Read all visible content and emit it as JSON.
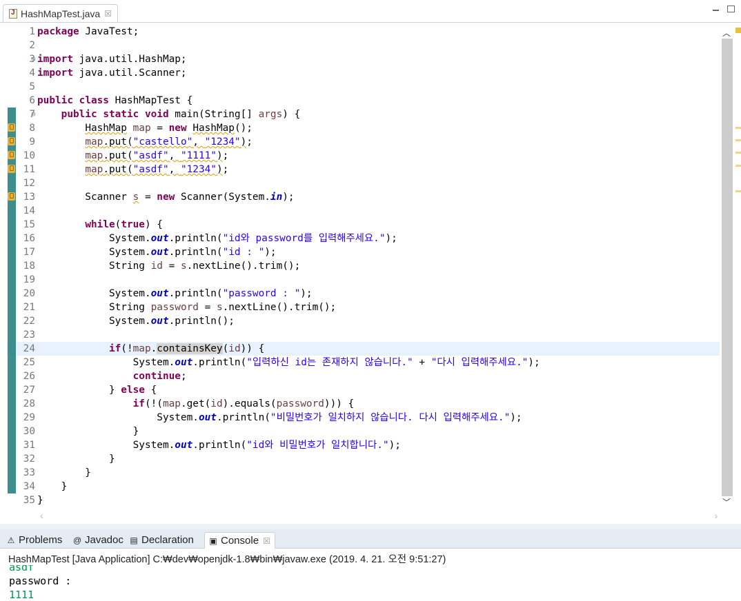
{
  "editor": {
    "tab_title": "HashMapTest.java",
    "close_glyph": "☒"
  },
  "code_lines": [
    {
      "n": "1",
      "html": "<span class=\"kw\">package</span> JavaTest;"
    },
    {
      "n": "2",
      "html": ""
    },
    {
      "n": "3",
      "html": "<span class=\"kw\">import</span> java.util.HashMap;",
      "fold": "⊖"
    },
    {
      "n": "4",
      "html": "<span class=\"kw\">import</span> java.util.Scanner;"
    },
    {
      "n": "5",
      "html": ""
    },
    {
      "n": "6",
      "html": "<span class=\"kw\">public</span> <span class=\"kw\">class</span> HashMapTest {"
    },
    {
      "n": "7",
      "html": "    <span class=\"kw\">public</span> <span class=\"kw\">static</span> <span class=\"kw\">void</span> main(String[] <span class=\"var\">args</span>) {",
      "fold": "⊖",
      "bar": true
    },
    {
      "n": "8",
      "html": "        <span class=\"warnu\">HashMap</span> <span class=\"var\">map</span> = <span class=\"kw\">new</span> <span class=\"warnu\">HashMap</span>();",
      "bar": true,
      "warn": true
    },
    {
      "n": "9",
      "html": "        <span class=\"warnu\"><span class=\"var\">map</span>.put(<span class=\"str\">\"castello\"</span>, <span class=\"str\">\"1234\"</span>)</span>;",
      "bar": true,
      "warn": true
    },
    {
      "n": "10",
      "html": "        <span class=\"warnu\"><span class=\"var\">map</span>.put(<span class=\"str\">\"asdf\"</span>, <span class=\"str\">\"1111\"</span>)</span>;",
      "bar": true,
      "warn": true
    },
    {
      "n": "11",
      "html": "        <span class=\"warnu\"><span class=\"var\">map</span>.put(<span class=\"str\">\"asdf\"</span>, <span class=\"str\">\"1234\"</span>)</span>;",
      "bar": true,
      "warn": true
    },
    {
      "n": "12",
      "html": "",
      "bar": true
    },
    {
      "n": "13",
      "html": "        Scanner <span class=\"var warnu\">s</span> = <span class=\"kw\">new</span> Scanner(System.<span class=\"fld\">in</span>);",
      "bar": true,
      "warn": true
    },
    {
      "n": "14",
      "html": "",
      "bar": true
    },
    {
      "n": "15",
      "html": "        <span class=\"kw\">while</span>(<span class=\"kw\">true</span>) {",
      "bar": true
    },
    {
      "n": "16",
      "html": "            System.<span class=\"fld\">out</span>.println(<span class=\"str\">\"id와 password를 입력해주세요.\"</span>);",
      "bar": true
    },
    {
      "n": "17",
      "html": "            System.<span class=\"fld\">out</span>.println(<span class=\"str\">\"id : \"</span>);",
      "bar": true
    },
    {
      "n": "18",
      "html": "            String <span class=\"var\">id</span> = <span class=\"var\">s</span>.nextLine().trim();",
      "bar": true
    },
    {
      "n": "19",
      "html": "",
      "bar": true
    },
    {
      "n": "20",
      "html": "            System.<span class=\"fld\">out</span>.println(<span class=\"str\">\"password : \"</span>);",
      "bar": true
    },
    {
      "n": "21",
      "html": "            String <span class=\"var\">password</span> = <span class=\"var\">s</span>.nextLine().trim();",
      "bar": true
    },
    {
      "n": "22",
      "html": "            System.<span class=\"fld\">out</span>.println();",
      "bar": true
    },
    {
      "n": "23",
      "html": "",
      "bar": true
    },
    {
      "n": "24",
      "html": "            <span class=\"kw\">if</span>(!<span class=\"var\">map</span>.<span class=\"hl\">containsKey</span>(<span class=\"var\">id</span>)) {",
      "bar": true,
      "current": true
    },
    {
      "n": "25",
      "html": "                System.<span class=\"fld\">out</span>.println(<span class=\"str\">\"입력하신 id는 존재하지 않습니다.\"</span> + <span class=\"str\">\"다시 입력해주세요.\"</span>);",
      "bar": true
    },
    {
      "n": "26",
      "html": "                <span class=\"kw\">continue</span>;",
      "bar": true
    },
    {
      "n": "27",
      "html": "            } <span class=\"kw\">else</span> {",
      "bar": true
    },
    {
      "n": "28",
      "html": "                <span class=\"kw\">if</span>(!(<span class=\"var\">map</span>.get(<span class=\"var\">id</span>).equals(<span class=\"var\">password</span>))) {",
      "bar": true
    },
    {
      "n": "29",
      "html": "                    System.<span class=\"fld\">out</span>.println(<span class=\"str\">\"비밀번호가 일치하지 않습니다. 다시 입력해주세요.\"</span>);",
      "bar": true
    },
    {
      "n": "30",
      "html": "                }",
      "bar": true
    },
    {
      "n": "31",
      "html": "                System.<span class=\"fld\">out</span>.println(<span class=\"str\">\"id와 비밀번호가 일치합니다.\"</span>);",
      "bar": true
    },
    {
      "n": "32",
      "html": "            }",
      "bar": true
    },
    {
      "n": "33",
      "html": "        }",
      "bar": true
    },
    {
      "n": "34",
      "html": "    }",
      "bar": true
    },
    {
      "n": "35",
      "html": "}"
    }
  ],
  "panel": {
    "tabs": [
      {
        "label": "Problems",
        "icon": "problems-icon",
        "glyph": "⚠"
      },
      {
        "label": "Javadoc",
        "icon": "javadoc-icon",
        "glyph": "@"
      },
      {
        "label": "Declaration",
        "icon": "declaration-icon",
        "glyph": "▤"
      },
      {
        "label": "Console",
        "icon": "console-icon",
        "glyph": "▣",
        "active": true
      }
    ],
    "console_header": "HashMapTest [Java Application] C:₩dev₩openjdk-1.8₩bin₩javaw.exe (2019. 4. 21. 오전 9:51:27)",
    "console_lines": [
      {
        "text": "asdf",
        "kind": "in"
      },
      {
        "text": "password : ",
        "kind": "out"
      },
      {
        "text": "1111",
        "kind": "in"
      }
    ]
  },
  "colors": {
    "accent": "#3d8f8f",
    "keyword": "#7f0055",
    "string": "#2a00ff",
    "console_input": "#009650"
  }
}
